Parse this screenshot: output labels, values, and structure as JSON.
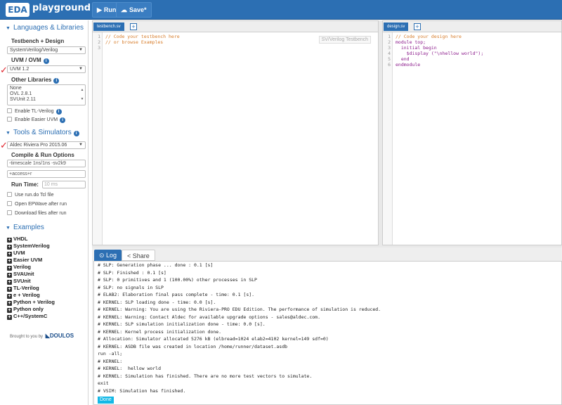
{
  "topbar": {
    "logo_eda": "EDA",
    "logo_play": "playground",
    "run_label": "Run",
    "save_label": "Save"
  },
  "sidebar": {
    "lang_section": "Languages & Libraries",
    "testbench_design_label": "Testbench + Design",
    "language_value": "SystemVerilog/Verilog",
    "uvm_label": "UVM / OVM",
    "uvm_value": "UVM 1.2",
    "other_libs_label": "Other Libraries",
    "other_libs": [
      "None",
      "OVL 2.8.1",
      "SVUnit 2.11"
    ],
    "enable_tl_verilog": "Enable TL-Verilog",
    "enable_easier_uvm": "Enable Easier UVM",
    "tools_section": "Tools & Simulators",
    "simulator_value": "Aldec Riviera Pro 2015.06",
    "compile_label": "Compile & Run Options",
    "compile_opts": "-timescale 1ns/1ns -sv2k9",
    "run_opts": "+access+r",
    "run_time_label": "Run Time:",
    "run_time_placeholder": "10 ms",
    "use_run_do": "Use run.do Tcl file",
    "open_epwave": "Open EPWave after run",
    "download_files": "Download files after run",
    "examples_section": "Examples",
    "examples": [
      "VHDL",
      "SystemVerilog",
      "UVM",
      "Easier UVM",
      "Verilog",
      "SVAUnit",
      "SVUnit",
      "TL-Verilog",
      "e + Verilog",
      "Python + Verilog",
      "Python only",
      "C++/SystemC"
    ],
    "brought_by": "Brought to you by",
    "doulos": "DOULOS"
  },
  "testbench": {
    "tab": "testbench.sv",
    "badge": "SV/Verilog Testbench",
    "lines": [
      "// Code your testbench here",
      "// or browse Examples",
      ""
    ]
  },
  "design": {
    "tab": "design.sv",
    "lines": [
      "// Code your design here",
      "module top;",
      "  initial begin",
      "    $display (\"\\nhellow world\");",
      "  end",
      "endmodule"
    ]
  },
  "log": {
    "log_tab": "Log",
    "share_tab": "Share",
    "lines": [
      "# SLP: Generation phase ... done : 0.1 [s]",
      "# SLP: Finished : 0.1 [s]",
      "# SLP: 0 primitives and 1 (100.00%) other processes in SLP",
      "# SLP: no signals in SLP",
      "# ELAB2: Elaboration final pass complete - time: 0.1 [s].",
      "# KERNEL: SLP loading done - time: 0.0 [s].",
      "# KERNEL: Warning: You are using the Riviera-PRO EDU Edition. The performance of simulation is reduced.",
      "# KERNEL: Warning: Contact Aldec for available upgrade options - sales@aldec.com.",
      "# KERNEL: SLP simulation initialization done - time: 0.0 [s].",
      "# KERNEL: Kernel process initialization done.",
      "# Allocation: Simulator allocated 5276 kB (elbread=1024 elab2=4102 kernel=149 sdf=0)",
      "# KERNEL: ASDB file was created in location /home/runner/dataset.asdb",
      "run -all;",
      "# KERNEL:",
      "# KERNEL:  hellow world",
      "# KERNEL: Simulation has finished. There are no more test vectors to simulate.",
      "exit",
      "# VSIM: Simulation has finished."
    ],
    "done": "Done"
  },
  "colors": {
    "brand": "#2c6fb3",
    "mark": "#e0222a",
    "done": "#13b8e6"
  }
}
